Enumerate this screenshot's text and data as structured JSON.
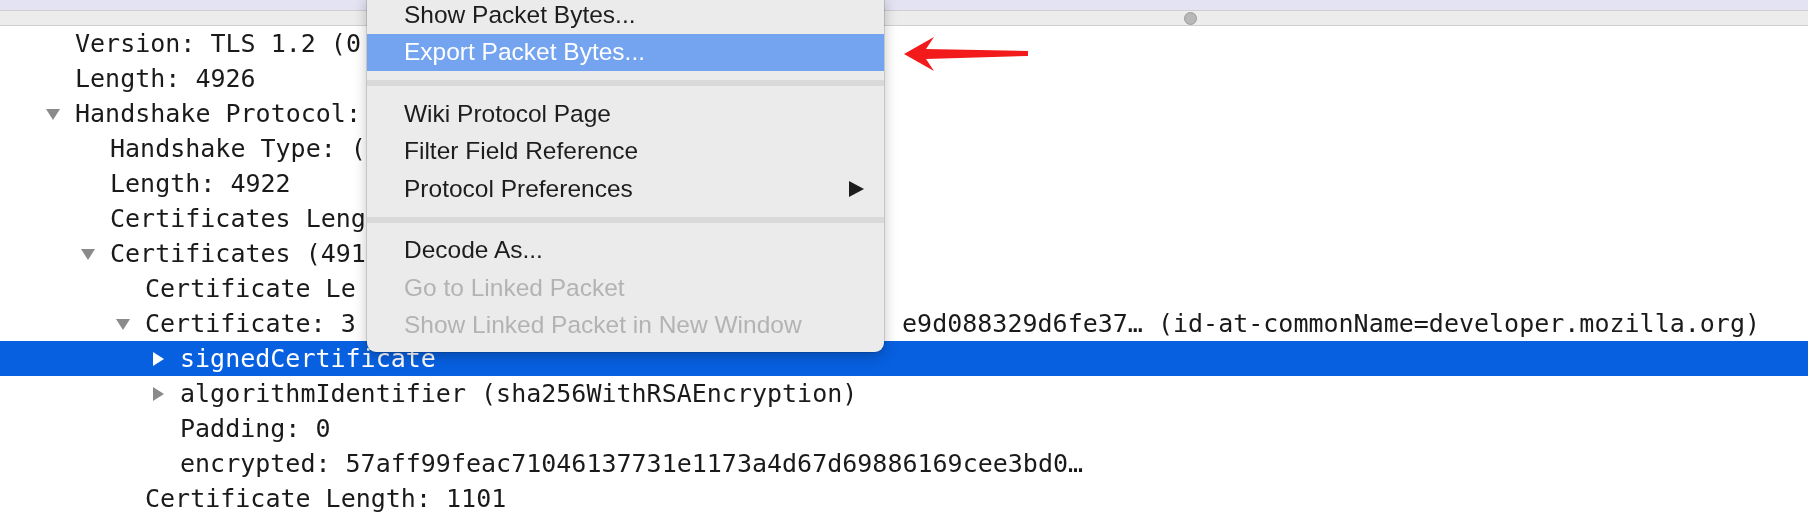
{
  "tree": [
    {
      "label": "Version: TLS 1.2 (0",
      "selected": false
    },
    {
      "label": "Length: 4926",
      "selected": false
    },
    {
      "label": "Handshake Protocol:",
      "selected": false,
      "expanded": true,
      "children": [
        {
          "label": "Handshake Type: (",
          "selected": false
        },
        {
          "label": "Length: 4922",
          "selected": false
        },
        {
          "label": "Certificates Leng",
          "selected": false
        },
        {
          "label": "Certificates (491",
          "selected": false,
          "expanded": true,
          "children": [
            {
              "label": "Certificate Le",
              "selected": false
            },
            {
              "label": "Certificate: 3",
              "text_after_menu": "e9d088329d6fe37… (id-at-commonName=developer.mozilla.org)",
              "selected": false,
              "expanded": true,
              "children": [
                {
                  "label": "signedCertificate",
                  "selected": true,
                  "expanded": false
                },
                {
                  "label": "algorithmIdentifier (sha256WithRSAEncryption)",
                  "selected": false,
                  "expanded": false
                },
                {
                  "label": "Padding: 0",
                  "selected": false
                },
                {
                  "label": "encrypted: 57aff99feac71046137731e1173a4d67d69886169cee3bd0…",
                  "selected": false
                }
              ]
            },
            {
              "label": "Certificate Length: 1101",
              "selected": false
            }
          ]
        }
      ]
    }
  ],
  "context_menu": [
    {
      "kind": "item",
      "label": "Show Packet Bytes...",
      "selected": false,
      "disabled": false,
      "submenu": false
    },
    {
      "kind": "item",
      "label": "Export Packet Bytes...",
      "selected": true,
      "disabled": false,
      "submenu": false
    },
    {
      "kind": "separator"
    },
    {
      "kind": "item",
      "label": "Wiki Protocol Page",
      "selected": false,
      "disabled": false,
      "submenu": false
    },
    {
      "kind": "item",
      "label": "Filter Field Reference",
      "selected": false,
      "disabled": false,
      "submenu": false
    },
    {
      "kind": "item",
      "label": "Protocol Preferences",
      "selected": false,
      "disabled": false,
      "submenu": true
    },
    {
      "kind": "separator"
    },
    {
      "kind": "item",
      "label": "Decode As...",
      "selected": false,
      "disabled": false,
      "submenu": false
    },
    {
      "kind": "item",
      "label": "Go to Linked Packet",
      "selected": false,
      "disabled": true,
      "submenu": false
    },
    {
      "kind": "item",
      "label": "Show Linked Packet in New Window",
      "selected": false,
      "disabled": true,
      "submenu": false
    }
  ]
}
